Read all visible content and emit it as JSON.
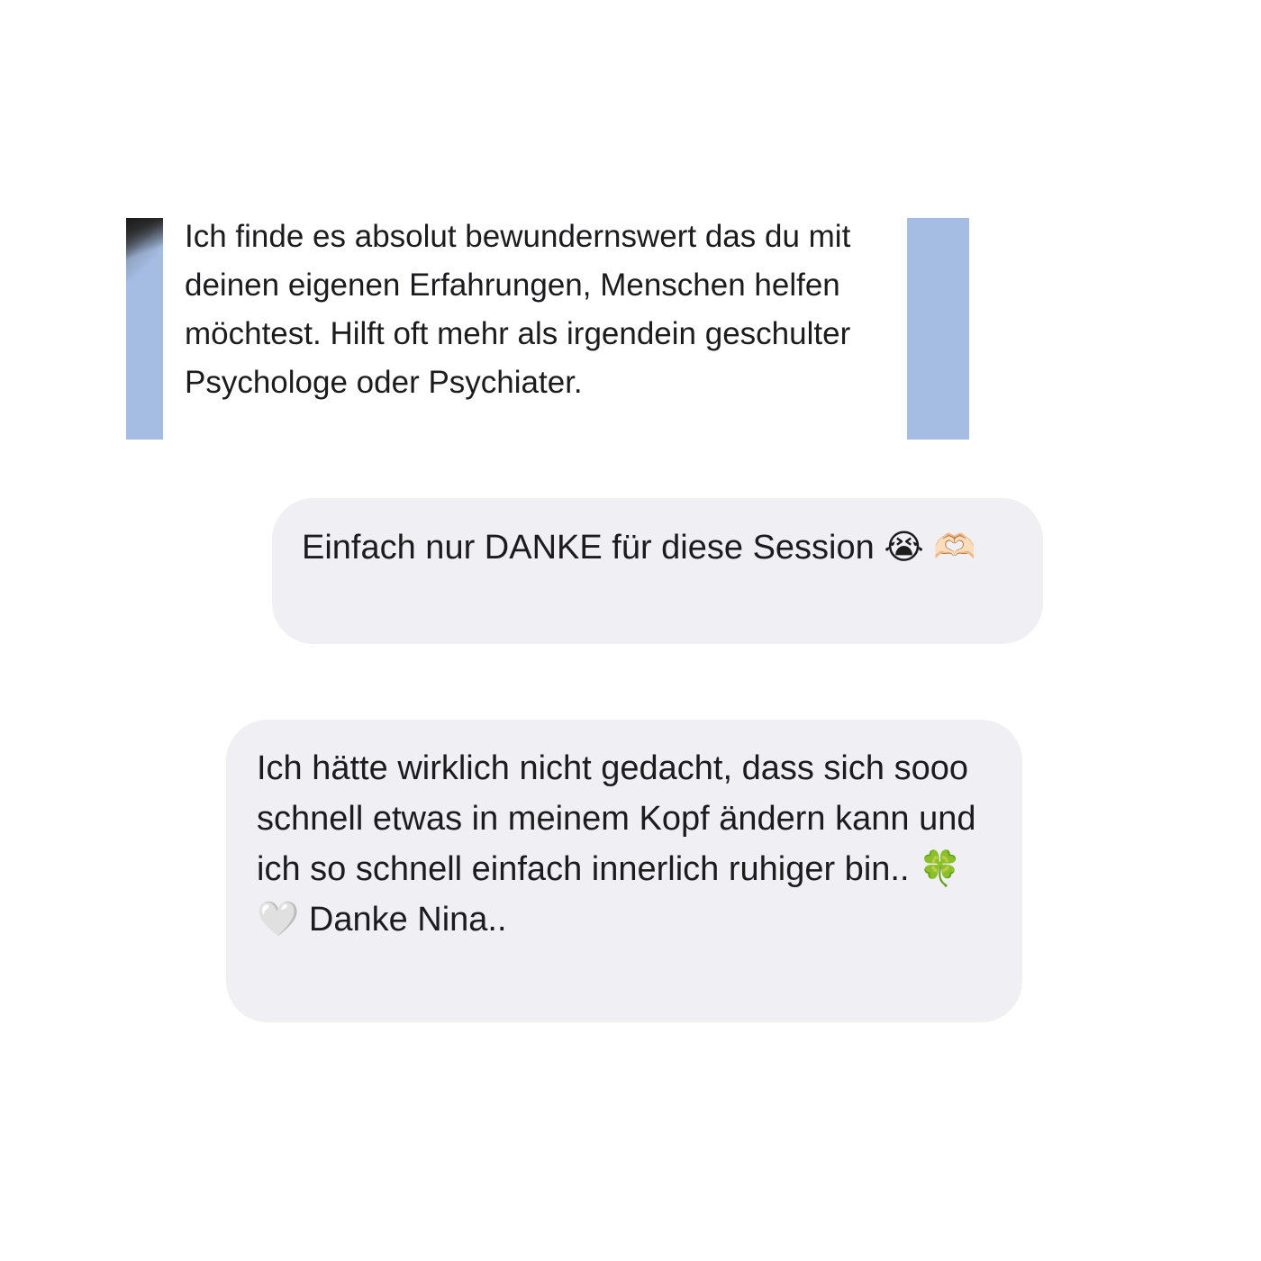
{
  "messages": [
    {
      "text": "Ich finde es absolut bewundernswert das du mit deinen eigenen Erfahrungen, Menschen helfen möchtest. Hilft oft mehr als irgendein geschulter Psychologe oder Psychiater."
    },
    {
      "text": "Einfach nur DANKE für diese Session 😭 🫶🏻"
    },
    {
      "text": "Ich hätte wirklich nicht gedacht, dass sich sooo schnell etwas in meinem Kopf ändern kann und ich so schnell einfach innerlich ruhiger bin.. 🍀🤍 Danke Nina.."
    }
  ],
  "colors": {
    "bubble_background": "#efeff4",
    "text": "#1c1c1e",
    "image_sky": "#a5bde3",
    "page_background": "#ffffff"
  }
}
